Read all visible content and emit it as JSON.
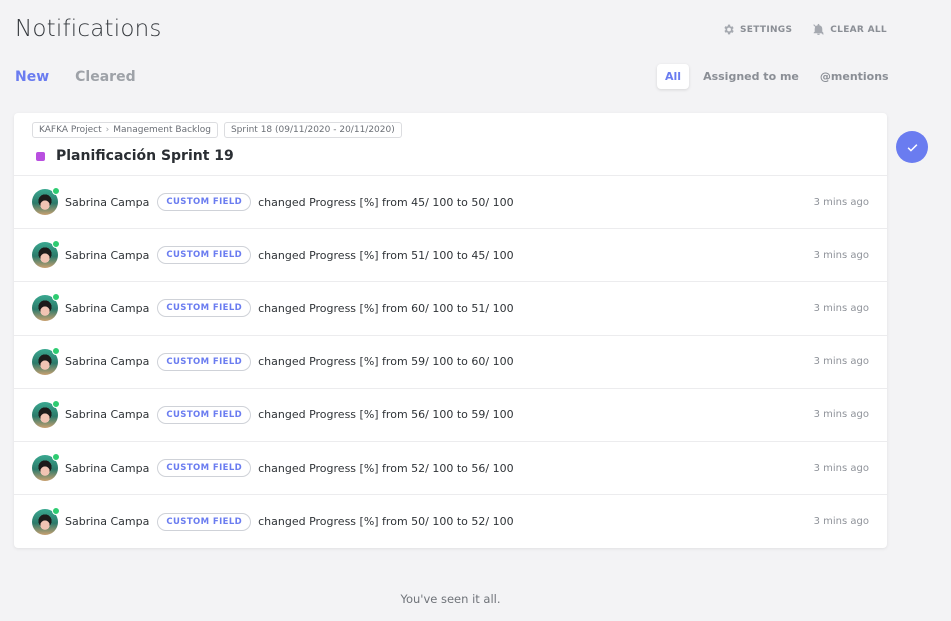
{
  "header": {
    "title": "Notifications",
    "settings_label": "SETTINGS",
    "clear_all_label": "CLEAR ALL"
  },
  "tabs": [
    {
      "label": "New",
      "active": true
    },
    {
      "label": "Cleared",
      "active": false
    }
  ],
  "filters": [
    {
      "label": "All",
      "active": true
    },
    {
      "label": "Assigned to me",
      "active": false
    },
    {
      "label": "@mentions",
      "active": false
    }
  ],
  "card": {
    "breadcrumb": {
      "project": "KAFKA Project",
      "list": "Management Backlog",
      "sprint": "Sprint 18 (09/11/2020 - 20/11/2020)"
    },
    "task_title": "Planificación Sprint 19",
    "task_color": "#b94fe0"
  },
  "notifications": [
    {
      "user": "Sabrina Campa",
      "badge": "CUSTOM FIELD",
      "message": "changed Progress [%] from 45/ 100 to 50/ 100",
      "time": "3 mins ago"
    },
    {
      "user": "Sabrina Campa",
      "badge": "CUSTOM FIELD",
      "message": "changed Progress [%] from 51/ 100 to 45/ 100",
      "time": "3 mins ago"
    },
    {
      "user": "Sabrina Campa",
      "badge": "CUSTOM FIELD",
      "message": "changed Progress [%] from 60/ 100 to 51/ 100",
      "time": "3 mins ago"
    },
    {
      "user": "Sabrina Campa",
      "badge": "CUSTOM FIELD",
      "message": "changed Progress [%] from 59/ 100 to 60/ 100",
      "time": "3 mins ago"
    },
    {
      "user": "Sabrina Campa",
      "badge": "CUSTOM FIELD",
      "message": "changed Progress [%] from 56/ 100 to 59/ 100",
      "time": "3 mins ago"
    },
    {
      "user": "Sabrina Campa",
      "badge": "CUSTOM FIELD",
      "message": "changed Progress [%] from 52/ 100 to 56/ 100",
      "time": "3 mins ago"
    },
    {
      "user": "Sabrina Campa",
      "badge": "CUSTOM FIELD",
      "message": "changed Progress [%] from 50/ 100 to 52/ 100",
      "time": "3 mins ago"
    }
  ],
  "footer": {
    "note": "You've seen it all."
  },
  "colors": {
    "accent": "#6a7cf0",
    "online": "#2ecc71"
  },
  "icons": {
    "settings": "gear-icon",
    "clear_all": "bell-off-icon",
    "mark_cleared": "check-icon"
  }
}
